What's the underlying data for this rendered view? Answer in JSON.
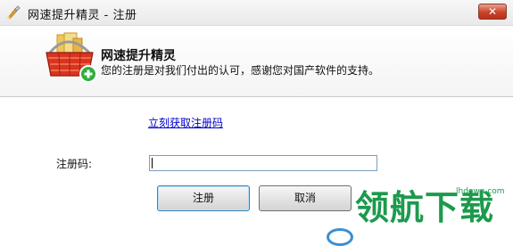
{
  "window": {
    "title": "网速提升精灵 - 注册",
    "close_label": "✕"
  },
  "header": {
    "product_name": "网速提升精灵",
    "description": "您的注册是对我们付出的认可，感谢您对国产软件的支持。",
    "icon": "shopping-basket-add-icon"
  },
  "form": {
    "get_code_link": "立刻获取注册码",
    "code_label": "注册码:",
    "code_value": ""
  },
  "buttons": {
    "register": "注册",
    "cancel": "取消"
  },
  "watermark": {
    "text": "领航下载",
    "url": "lhdown.com"
  },
  "colors": {
    "link": "#0000cc",
    "close_button": "#c7432a",
    "watermark": "#1c9a4c"
  }
}
